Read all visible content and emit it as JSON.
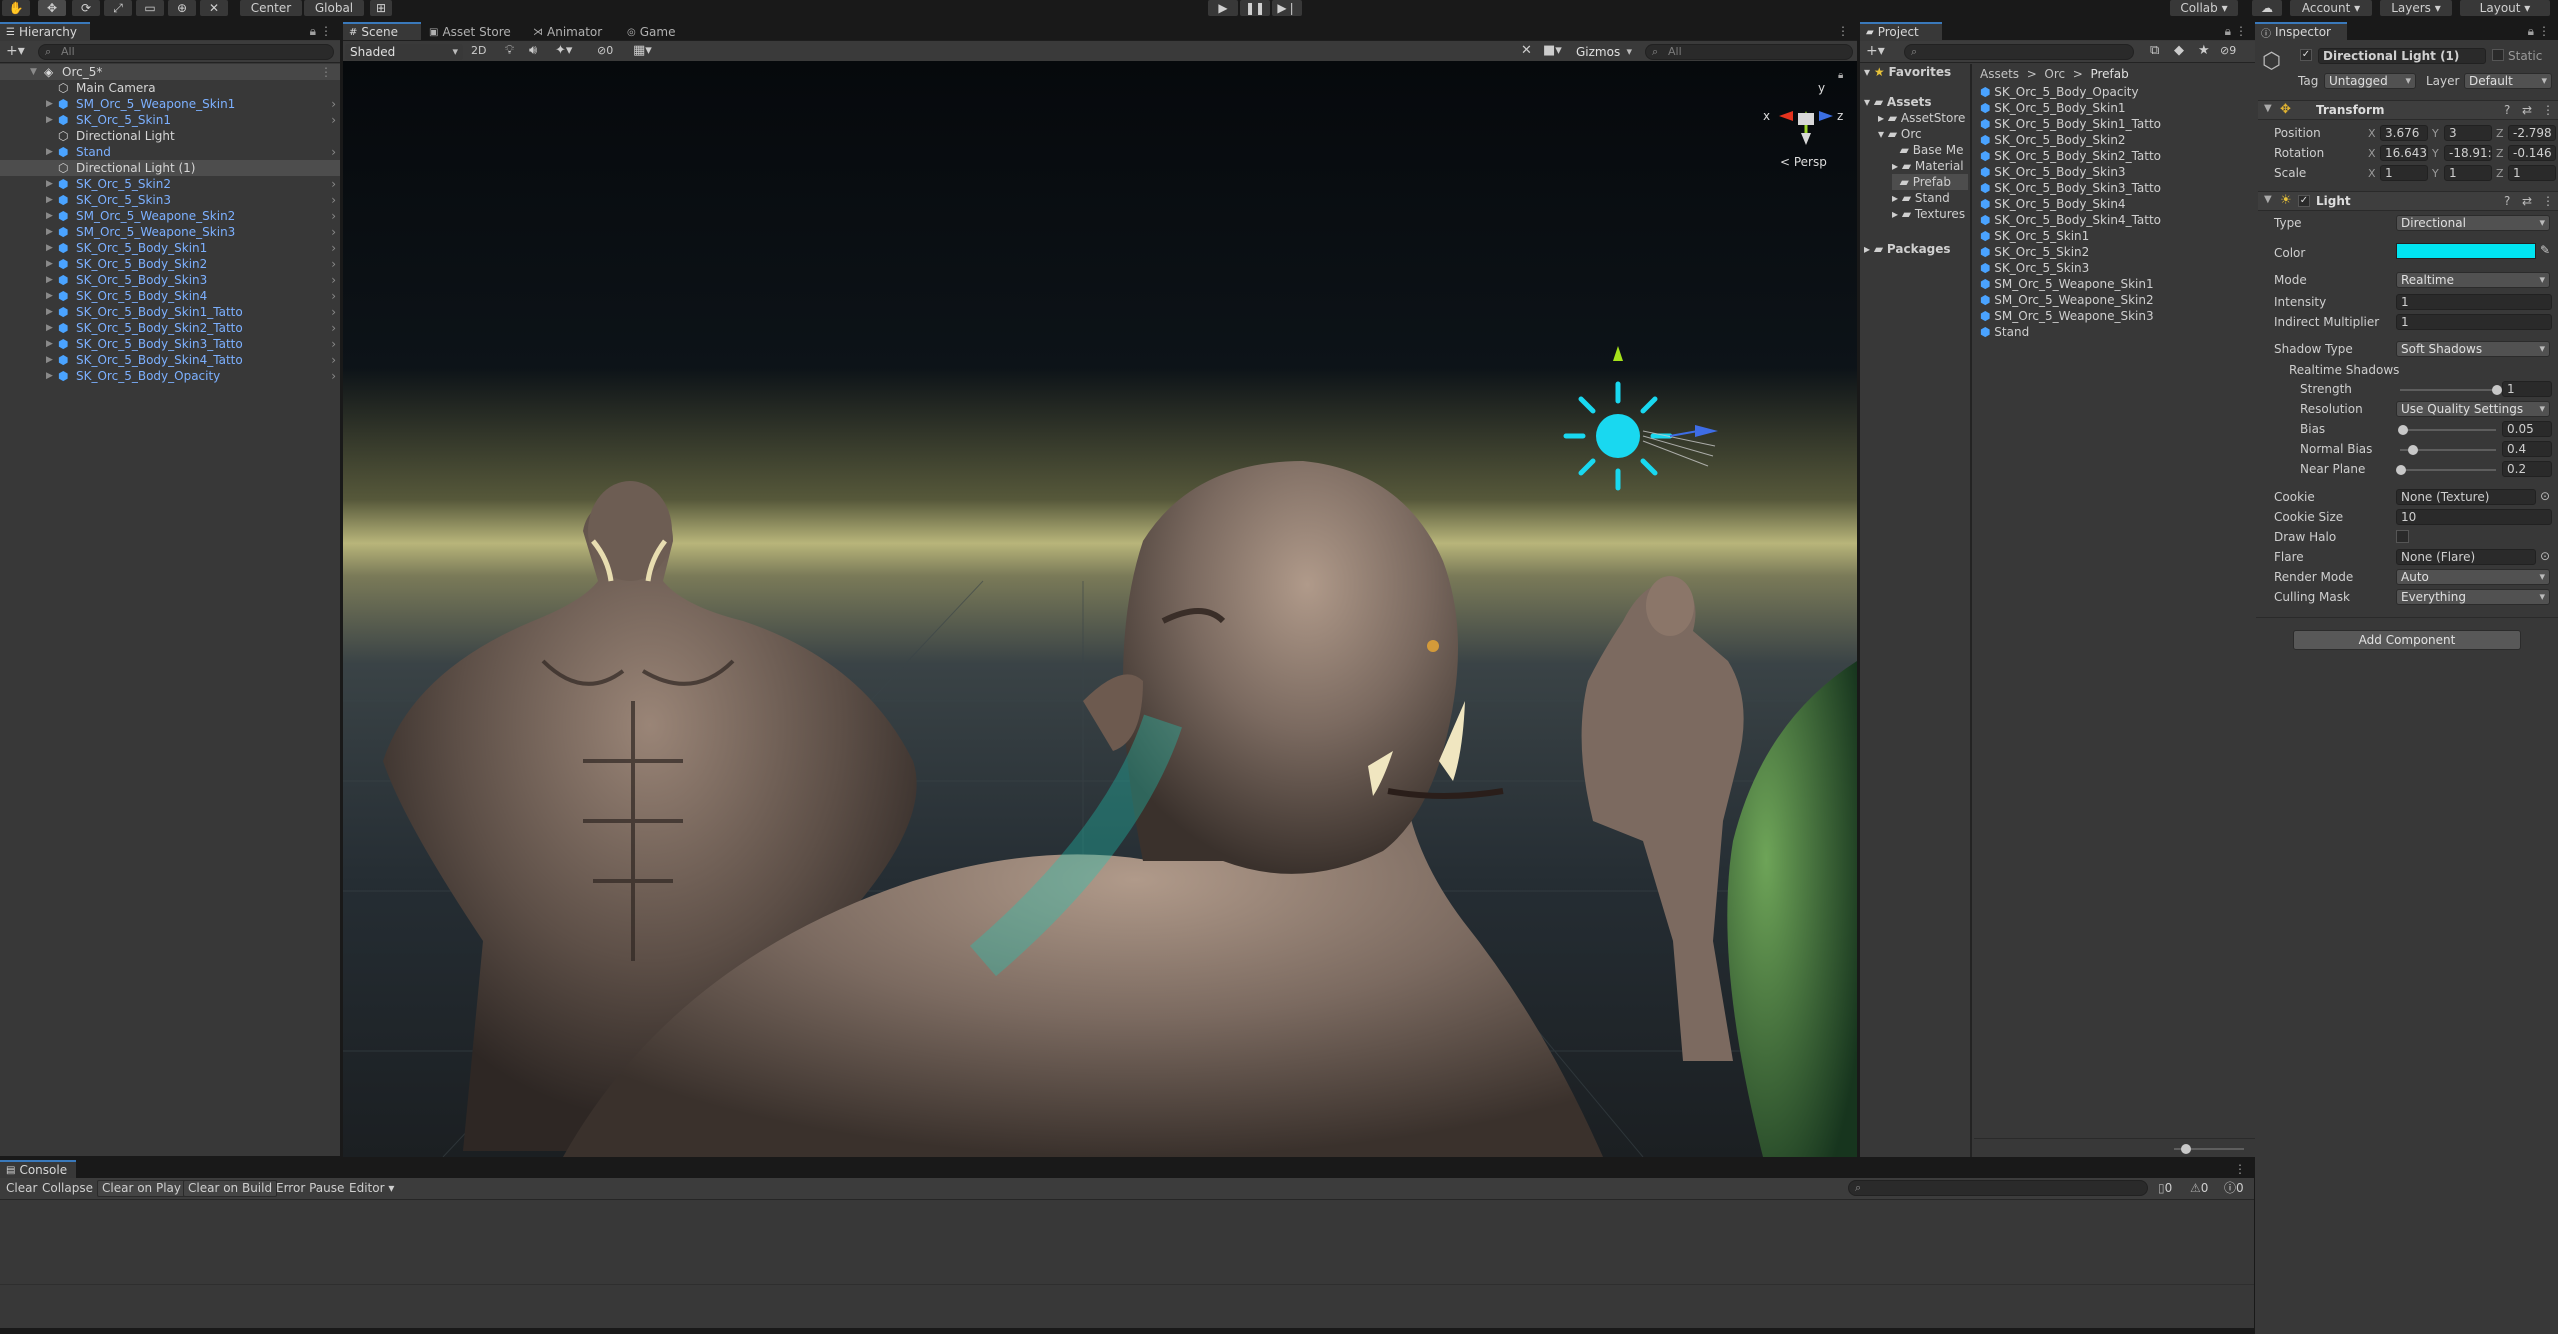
{
  "toolbar": {
    "pivot_center": "Center",
    "pivot_global": "Global",
    "collab": "Collab",
    "account": "Account",
    "layers": "Layers",
    "layout": "Layout"
  },
  "hierarchy": {
    "tab": "Hierarchy",
    "search_placeholder": "All",
    "scene_name": "Orc_5*",
    "items": [
      {
        "label": "Main Camera",
        "kind": "camera",
        "style": "white"
      },
      {
        "label": "SM_Orc_5_Weapone_Skin1",
        "kind": "prefab",
        "style": "blue"
      },
      {
        "label": "SK_Orc_5_Skin1",
        "kind": "prefab",
        "style": "blue"
      },
      {
        "label": "Directional Light",
        "kind": "light",
        "style": "white"
      },
      {
        "label": "Stand",
        "kind": "prefab",
        "style": "blue"
      },
      {
        "label": "Directional Light (1)",
        "kind": "light",
        "style": "white"
      },
      {
        "label": "SK_Orc_5_Skin2",
        "kind": "prefab",
        "style": "blue"
      },
      {
        "label": "SK_Orc_5_Skin3",
        "kind": "prefab",
        "style": "blue"
      },
      {
        "label": "SM_Orc_5_Weapone_Skin2",
        "kind": "prefab",
        "style": "blue"
      },
      {
        "label": "SM_Orc_5_Weapone_Skin3",
        "kind": "prefab",
        "style": "blue"
      },
      {
        "label": "SK_Orc_5_Body_Skin1",
        "kind": "prefab",
        "style": "blue"
      },
      {
        "label": "SK_Orc_5_Body_Skin2",
        "kind": "prefab",
        "style": "blue"
      },
      {
        "label": "SK_Orc_5_Body_Skin3",
        "kind": "prefab",
        "style": "blue"
      },
      {
        "label": "SK_Orc_5_Body_Skin4",
        "kind": "prefab",
        "style": "blue"
      },
      {
        "label": "SK_Orc_5_Body_Skin1_Tatto",
        "kind": "prefab",
        "style": "blue"
      },
      {
        "label": "SK_Orc_5_Body_Skin2_Tatto",
        "kind": "prefab",
        "style": "blue"
      },
      {
        "label": "SK_Orc_5_Body_Skin3_Tatto",
        "kind": "prefab",
        "style": "blue"
      },
      {
        "label": "SK_Orc_5_Body_Skin4_Tatto",
        "kind": "prefab",
        "style": "blue"
      },
      {
        "label": "SK_Orc_5_Body_Opacity",
        "kind": "prefab",
        "style": "blue"
      }
    ]
  },
  "scene": {
    "tabs": [
      "Scene",
      "Asset Store",
      "Animator",
      "Game"
    ],
    "draw_mode": "Shaded",
    "mode_2d": "2D",
    "hidden_count": "0",
    "gizmos": "Gizmos",
    "search_placeholder": "All",
    "persp_label": "< Persp",
    "axis_x": "x",
    "axis_y": "y",
    "axis_z": "z"
  },
  "project": {
    "tab": "Project",
    "favorites": "Favorites",
    "assets": "Assets",
    "tree": [
      "AssetStore",
      "Orc",
      "Base Me",
      "Material",
      "Prefab",
      "Stand",
      "Textures"
    ],
    "packages": "Packages",
    "breadcrumb": [
      "Assets",
      "Orc",
      "Prefab"
    ],
    "files": [
      "SK_Orc_5_Body_Opacity",
      "SK_Orc_5_Body_Skin1",
      "SK_Orc_5_Body_Skin1_Tatto",
      "SK_Orc_5_Body_Skin2",
      "SK_Orc_5_Body_Skin2_Tatto",
      "SK_Orc_5_Body_Skin3",
      "SK_Orc_5_Body_Skin3_Tatto",
      "SK_Orc_5_Body_Skin4",
      "SK_Orc_5_Body_Skin4_Tatto",
      "SK_Orc_5_Skin1",
      "SK_Orc_5_Skin2",
      "SK_Orc_5_Skin3",
      "SM_Orc_5_Weapone_Skin1",
      "SM_Orc_5_Weapone_Skin2",
      "SM_Orc_5_Weapone_Skin3",
      "Stand"
    ],
    "hidden_count": "9"
  },
  "inspector": {
    "tab": "Inspector",
    "object_name": "Directional Light (1)",
    "static_label": "Static",
    "tag_label": "Tag",
    "tag_value": "Untagged",
    "layer_label": "Layer",
    "layer_value": "Default",
    "transform": {
      "title": "Transform",
      "position_label": "Position",
      "rotation_label": "Rotation",
      "scale_label": "Scale",
      "position": [
        "3.676",
        "3",
        "-2.798"
      ],
      "rotation": [
        "16.643",
        "-18.91:",
        "-0.146"
      ],
      "scale": [
        "1",
        "1",
        "1"
      ]
    },
    "light": {
      "title": "Light",
      "type_label": "Type",
      "type_value": "Directional",
      "color_label": "Color",
      "color_value": "#00e5f2",
      "mode_label": "Mode",
      "mode_value": "Realtime",
      "intensity_label": "Intensity",
      "intensity_value": "1",
      "indirect_label": "Indirect Multiplier",
      "indirect_value": "1",
      "shadow_type_label": "Shadow Type",
      "shadow_type_value": "Soft Shadows",
      "realtime_shadows_label": "Realtime Shadows",
      "strength_label": "Strength",
      "strength_value": "1",
      "strength_fraction": 1.0,
      "resolution_label": "Resolution",
      "resolution_value": "Use Quality Settings",
      "bias_label": "Bias",
      "bias_value": "0.05",
      "bias_fraction": 0.025,
      "normal_bias_label": "Normal Bias",
      "normal_bias_value": "0.4",
      "normal_bias_fraction": 0.13,
      "near_plane_label": "Near Plane",
      "near_plane_value": "0.2",
      "near_plane_fraction": 0.0,
      "cookie_label": "Cookie",
      "cookie_value": "None (Texture)",
      "cookie_size_label": "Cookie Size",
      "cookie_size_value": "10",
      "draw_halo_label": "Draw Halo",
      "flare_label": "Flare",
      "flare_value": "None (Flare)",
      "render_mode_label": "Render Mode",
      "render_mode_value": "Auto",
      "culling_mask_label": "Culling Mask",
      "culling_mask_value": "Everything"
    },
    "add_component": "Add Component"
  },
  "console": {
    "tab": "Console",
    "clear": "Clear",
    "collapse": "Collapse",
    "clear_on_play": "Clear on Play",
    "clear_on_build": "Clear on Build",
    "error_pause": "Error Pause",
    "editor": "Editor",
    "log_count": "0",
    "warn_count": "0",
    "error_count": "0"
  }
}
